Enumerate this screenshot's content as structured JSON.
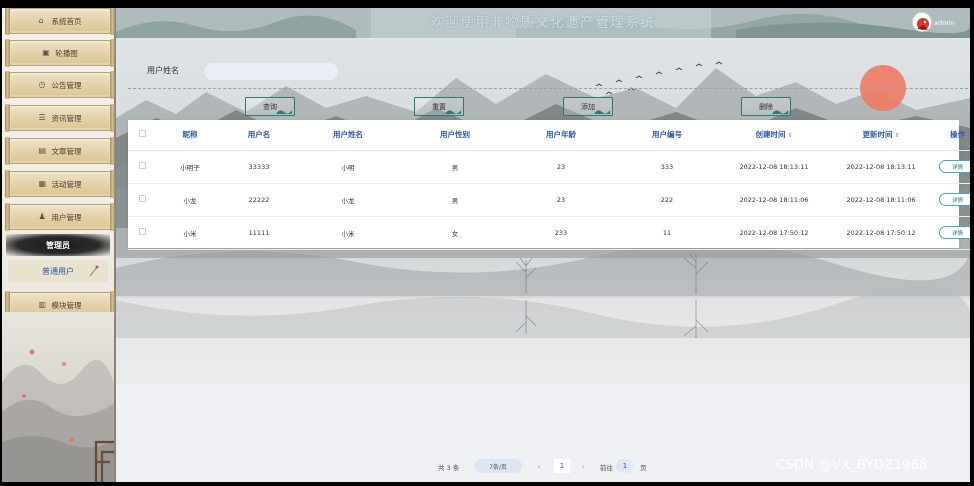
{
  "header": {
    "title": "欢迎使用非物质文化遗产管理系统",
    "user": "admin"
  },
  "sidebar": {
    "items": [
      {
        "label": "系统首页",
        "icon": "home-icon"
      },
      {
        "label": "轮播图",
        "icon": "image-icon"
      },
      {
        "label": "公告管理",
        "icon": "notice-icon"
      },
      {
        "label": "资讯管理",
        "icon": "news-icon"
      },
      {
        "label": "文章管理",
        "icon": "article-icon"
      },
      {
        "label": "活动管理",
        "icon": "activity-icon"
      },
      {
        "label": "用户管理",
        "icon": "user-icon"
      }
    ],
    "group_label": "管理员",
    "active_item": "普通用户",
    "last_item": {
      "label": "模块管理",
      "icon": "module-icon"
    }
  },
  "search": {
    "label": "用户姓名",
    "value": ""
  },
  "toolbar": {
    "query": "查询",
    "reset": "重置",
    "add": "添加",
    "delete": "删除"
  },
  "table": {
    "columns": [
      "昵称",
      "用户名",
      "用户姓名",
      "用户性别",
      "用户年龄",
      "用户编号",
      "创建时间",
      "更新时间",
      "操作"
    ],
    "sort_icon": "⇕",
    "action_label": "详情",
    "rows": [
      [
        "小明子",
        "33333",
        "小明",
        "男",
        "23",
        "333",
        "2022-12-08 18:13:11",
        "2022-12-08 18:13:11"
      ],
      [
        "小龙",
        "22222",
        "小龙",
        "男",
        "23",
        "222",
        "2022-12-08 18:11:06",
        "2022-12-08 18:11:06"
      ],
      [
        "小米",
        "11111",
        "小米",
        "女",
        "233",
        "11",
        "2022-12-08 17:50:12",
        "2022-12-08 17:50:12"
      ]
    ]
  },
  "pager": {
    "total": "共 3 条",
    "page_size": "7条/页",
    "current_page": "1",
    "goto_label": "前往",
    "goto_value": "1",
    "suffix": "页",
    "prev": "‹",
    "next": "›"
  },
  "watermark": "CSDN @VX_BYDZ1988",
  "colors": {
    "accent": "#2e5aa8",
    "teal": "#2e7a73",
    "sun": "#f06b55"
  }
}
